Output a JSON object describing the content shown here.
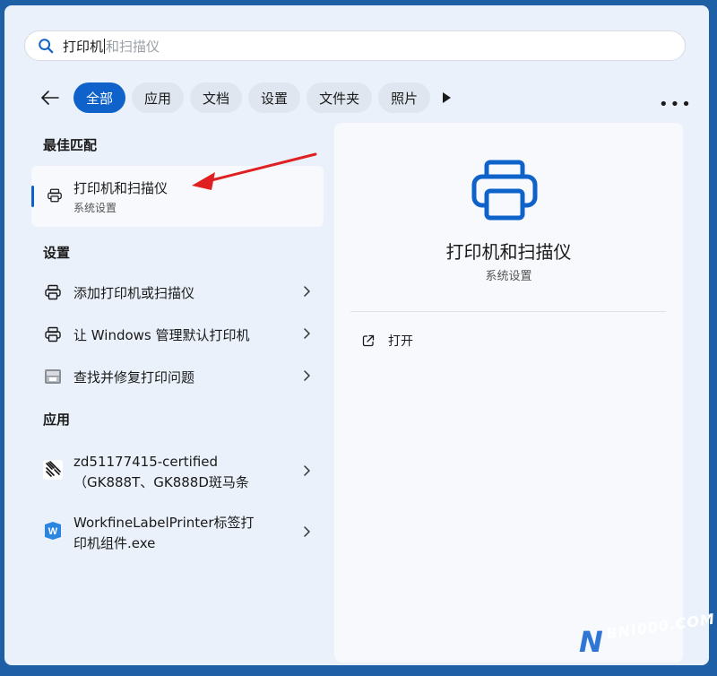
{
  "search": {
    "typed": "打印机",
    "suggested": "和扫描仪"
  },
  "filters": {
    "chips": [
      "全部",
      "应用",
      "文档",
      "设置",
      "文件夹",
      "照片"
    ],
    "active_index": 0
  },
  "sections": {
    "best": "最佳匹配",
    "settings": "设置",
    "apps": "应用"
  },
  "best_match": {
    "title": "打印机和扫描仪",
    "subtitle": "系统设置"
  },
  "settings_items": [
    {
      "label": "添加打印机或扫描仪",
      "icon": "printer-icon"
    },
    {
      "label": "让 Windows 管理默认打印机",
      "icon": "printer-icon"
    },
    {
      "label": "查找并修复打印问题",
      "icon": "troubleshoot-printer-icon"
    }
  ],
  "app_items": [
    {
      "line1": "zd51177415-certified",
      "line2": "（GK888T、GK888D斑马条",
      "icon": "zebra-app-icon"
    },
    {
      "line1": "WorkfineLabelPrinter标签打",
      "line2": "印机组件.exe",
      "icon": "workfine-app-icon"
    }
  ],
  "preview": {
    "title": "打印机和扫描仪",
    "subtitle": "系统设置",
    "open_label": "打开"
  },
  "watermark": {
    "text": "BNI000.COM",
    "letter": "N"
  },
  "colors": {
    "accent": "#0f62c9",
    "annotation_arrow": "#e02020",
    "desktop": "#1f5fa6"
  }
}
